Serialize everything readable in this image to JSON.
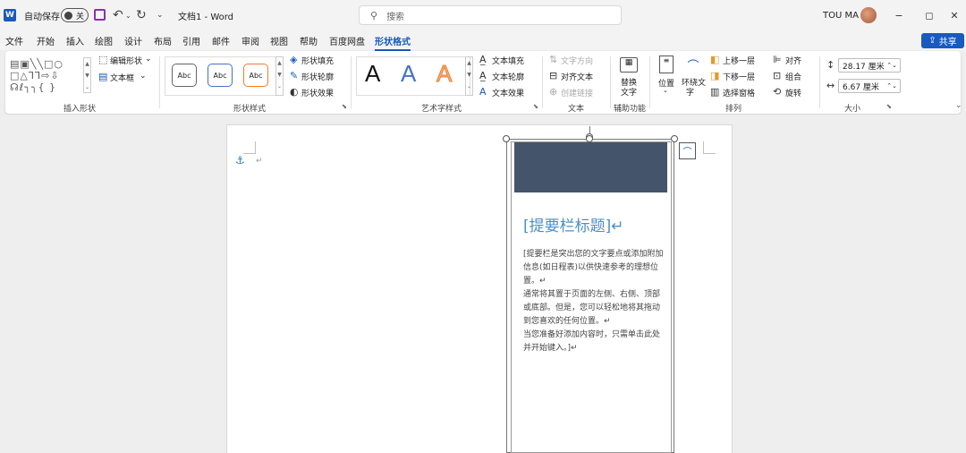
{
  "titlebar": {
    "app_letter": "W",
    "autosave_label": "自动保存",
    "autosave_state": "关",
    "doc_title": "文档1 - Word",
    "search_placeholder": "搜索",
    "user_name": "TOU MA",
    "minimize": "−",
    "maximize": "◻",
    "close": "✕"
  },
  "tabs": [
    "文件",
    "开始",
    "插入",
    "绘图",
    "设计",
    "布局",
    "引用",
    "邮件",
    "审阅",
    "视图",
    "帮助",
    "百度网盘",
    "形状格式"
  ],
  "active_tab": "形状格式",
  "share_label": "共享",
  "ribbon": {
    "insert_shapes": {
      "label": "插入形状",
      "edit_shape": "编辑形状",
      "text_box": "文本框"
    },
    "shape_styles": {
      "label": "形状样式",
      "styles": [
        "Abc",
        "Abc",
        "Abc"
      ],
      "fill": "形状填充",
      "outline": "形状轮廓",
      "effects": "形状效果"
    },
    "wordart": {
      "label": "艺术字样式",
      "letters": [
        "A",
        "A",
        "A"
      ],
      "text_fill": "文本填充",
      "text_outline": "文本轮廓",
      "text_effects": "文本效果"
    },
    "text": {
      "label": "文本",
      "direction": "文字方向",
      "align": "对齐文本",
      "link": "创建链接"
    },
    "accessibility": {
      "label": "辅助功能",
      "alt_text_1": "替换",
      "alt_text_2": "文字"
    },
    "arrange": {
      "label": "排列",
      "position": "位置",
      "wrap_1": "环绕文",
      "wrap_2": "字",
      "bring_forward": "上移一层",
      "send_backward": "下移一层",
      "selection_pane": "选择窗格",
      "align": "对齐",
      "group": "组合",
      "rotate": "旋转"
    },
    "size": {
      "label": "大小",
      "height": "28.17 厘米",
      "width": "6.67 厘米"
    }
  },
  "document": {
    "sidebar_title": "[提要栏标题]↵",
    "sidebar_paragraphs": [
      "[提要栏是突出您的文字要点或添加附加信息(如日程表)以供快速参考的理想位置。↵",
      "通常将其置于页面的左侧、右侧、顶部或底部。但是，您可以轻松地将其拖动到您喜欢的任何位置。↵",
      "当您准备好添加内容时，只需单击此处并开始键入。]↵"
    ],
    "para_mark": "↵"
  },
  "colors": {
    "accent": "#185abd",
    "sidebar_header": "#44546a",
    "sidebar_title": "#4a90c8"
  }
}
